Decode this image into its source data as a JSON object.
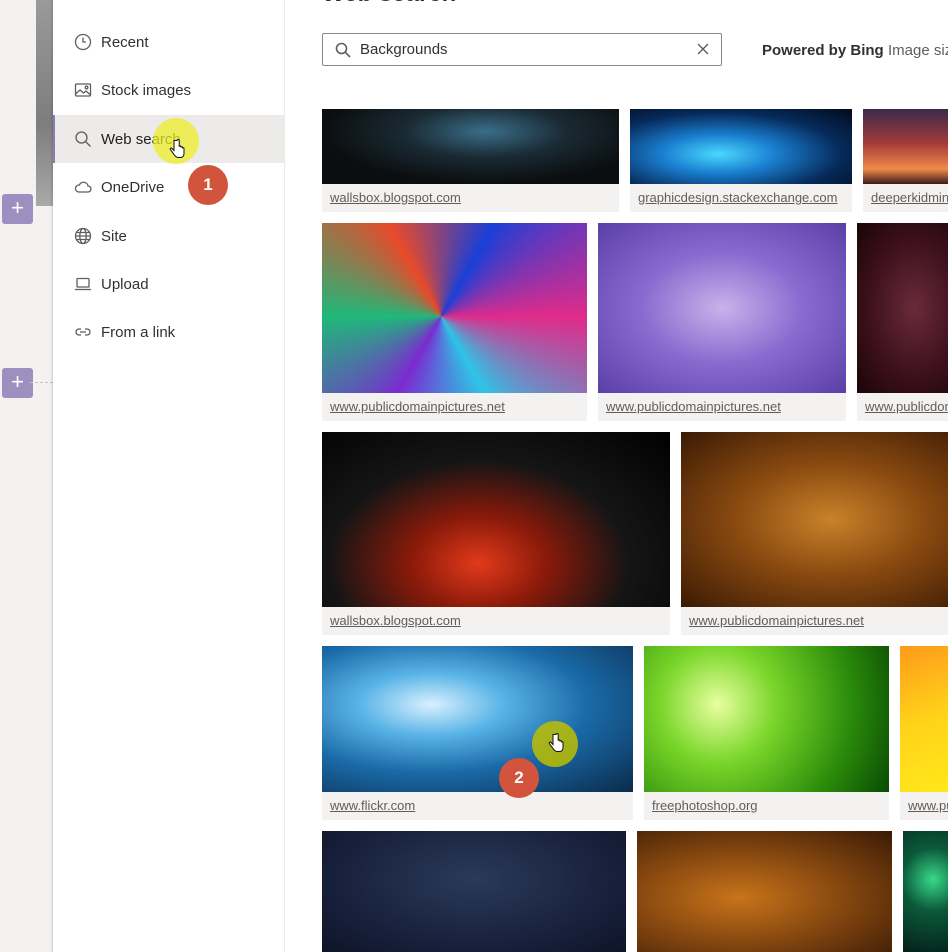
{
  "nav": {
    "items": [
      {
        "label": "Recent",
        "icon": "clock-icon"
      },
      {
        "label": "Stock images",
        "icon": "image-icon"
      },
      {
        "label": "Web search",
        "icon": "search-icon",
        "active": true
      },
      {
        "label": "OneDrive",
        "icon": "cloud-icon"
      },
      {
        "label": "Site",
        "icon": "globe-icon"
      },
      {
        "label": "Upload",
        "icon": "laptop-icon"
      },
      {
        "label": "From a link",
        "icon": "link-icon"
      }
    ]
  },
  "main": {
    "title": "Web search",
    "search": {
      "value": "Backgrounds"
    },
    "powered_by": "Powered by Bing",
    "image_size": "Image size"
  },
  "results": [
    {
      "source": "wallsbox.blogspot.com"
    },
    {
      "source": "graphicdesign.stackexchange.com"
    },
    {
      "source": "deeperkidministry.com"
    },
    {
      "source": "www.publicdomainpictures.net"
    },
    {
      "source": "www.publicdomainpictures.net"
    },
    {
      "source": "www.publicdomainpictures.net"
    },
    {
      "source": "wallsbox.blogspot.com"
    },
    {
      "source": "www.publicdomainpictures.net"
    },
    {
      "source": "www.flickr.com"
    },
    {
      "source": "freephotoshop.org"
    },
    {
      "source": "www.publicdomainpictures.net"
    },
    {
      "source": ""
    },
    {
      "source": ""
    },
    {
      "source": ""
    }
  ],
  "markers": {
    "step1": "1",
    "step2": "2"
  },
  "colors": {
    "accent": "#8a7ab8",
    "step_badge": "#d3543c",
    "highlight": "#ecec28"
  }
}
